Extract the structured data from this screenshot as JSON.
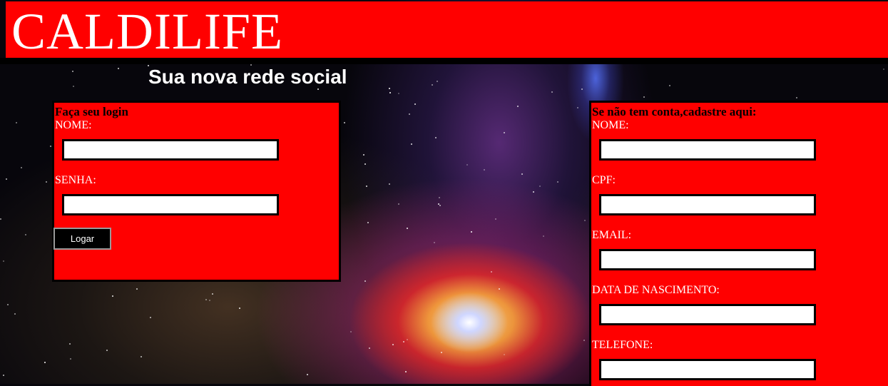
{
  "header": {
    "brand": "CALDILIFE",
    "tagline": "Sua nova rede social"
  },
  "login": {
    "title": "Faça seu login",
    "fields": [
      {
        "label": "NOME:",
        "value": ""
      },
      {
        "label": "SENHA:",
        "value": ""
      }
    ],
    "button_label": "Logar"
  },
  "signup": {
    "title": "Se não tem conta,cadastre aqui:",
    "fields": [
      {
        "label": "NOME:",
        "value": ""
      },
      {
        "label": "CPF:",
        "value": ""
      },
      {
        "label": "EMAIL:",
        "value": ""
      },
      {
        "label": "DATA DE NASCIMENTO:",
        "value": ""
      },
      {
        "label": "TELEFONE:",
        "value": ""
      }
    ]
  },
  "colors": {
    "accent": "#ff0000",
    "background": "#07060c",
    "text_light": "#ffffff",
    "text_dark": "#000000"
  }
}
